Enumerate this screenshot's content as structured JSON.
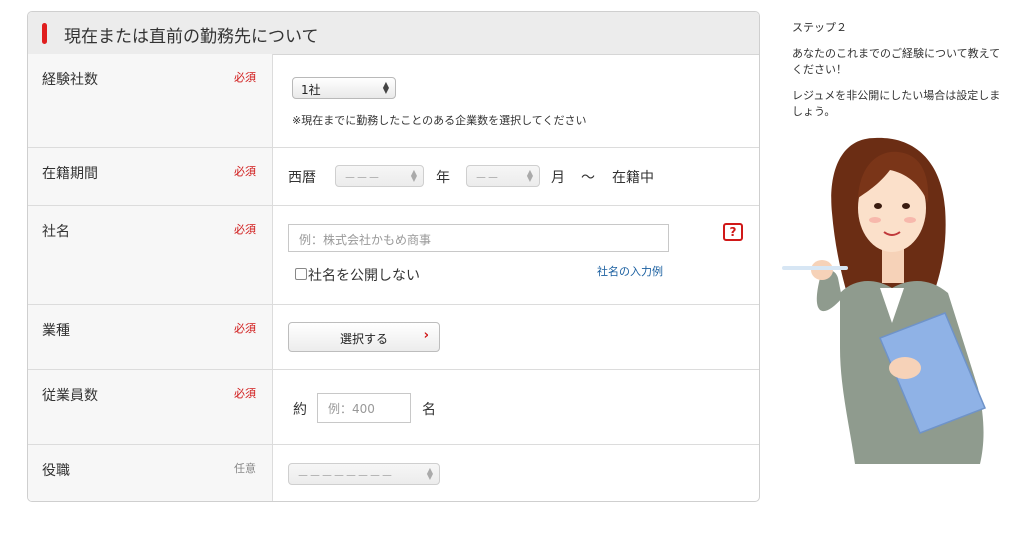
{
  "section": {
    "title": "現在または直前の勤務先について"
  },
  "rows": {
    "companies": {
      "label": "経験社数",
      "badge": "必須",
      "select_value": "1社",
      "note": "※現在までに勤務したことのある企業数を選択してください"
    },
    "period": {
      "label": "在籍期間",
      "badge": "必須",
      "prefix": "西暦",
      "year_select": "－－－",
      "year_unit": "年",
      "month_select": "－－",
      "month_unit": "月",
      "tilde": "〜",
      "current": "在籍中"
    },
    "company_name": {
      "label": "社名",
      "badge": "必須",
      "placeholder": "例：株式会社かもめ商事",
      "help": "?",
      "checkbox_label": "社名を公開しない",
      "example_link": "社名の入力例"
    },
    "industry": {
      "label": "業種",
      "badge": "必須",
      "button_label": "選択する"
    },
    "employees": {
      "label": "従業員数",
      "badge": "必須",
      "prefix": "約",
      "placeholder": "例：400",
      "suffix": "名"
    },
    "position": {
      "label": "役職",
      "badge": "任意",
      "select_value": "－－－－－－－－"
    }
  },
  "sidebar": {
    "step": "ステップ２",
    "text1": "あなたのこれまでのご経験について教えてください！",
    "text2": "レジュメを非公開にしたい場合は設定しましょう。"
  },
  "colors": {
    "accent": "#e01e1e",
    "required": "#d01818",
    "link": "#1a5fa0",
    "label_bg": "#f7f7f7",
    "header_bg": "#ececec"
  }
}
